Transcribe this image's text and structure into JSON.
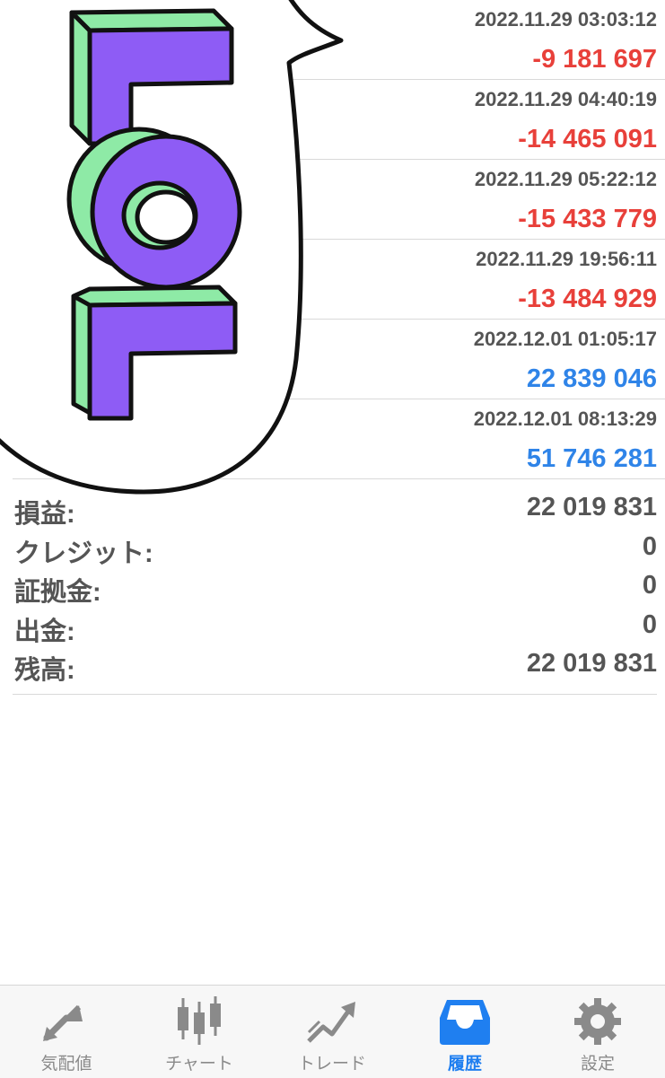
{
  "deals": [
    {
      "time": "2022.11.29 03:03:12",
      "profit": "-9 181 697",
      "sign": "neg"
    },
    {
      "time": "2022.11.29 04:40:19",
      "profit": "-14 465 091",
      "sign": "neg"
    },
    {
      "time": "2022.11.29 05:22:12",
      "profit": "-15 433 779",
      "sign": "neg"
    },
    {
      "time": "2022.11.29 19:56:11",
      "profit": "-13 484 929",
      "sign": "neg"
    },
    {
      "time": "2022.12.01 01:05:17",
      "profit": "22 839 046",
      "sign": "pos"
    },
    {
      "time": "2022.12.01 08:13:29",
      "profit": "51 746 281",
      "sign": "pos"
    }
  ],
  "summary": {
    "profit_label": "損益:",
    "profit_value": "22 019 831",
    "credit_label": "クレジット:",
    "credit_value": "0",
    "deposit_label": "証拠金:",
    "deposit_value": "0",
    "withdrawal_label": "出金:",
    "withdrawal_value": "0",
    "balance_label": "残高:",
    "balance_value": "22 019 831"
  },
  "sticker": {
    "text": "LOL"
  },
  "tabs": [
    {
      "label": "気配値",
      "icon": "quotes-arrows-icon"
    },
    {
      "label": "チャート",
      "icon": "candlestick-chart-icon"
    },
    {
      "label": "トレード",
      "icon": "trade-trend-icon"
    },
    {
      "label": "履歴",
      "icon": "history-tray-icon"
    },
    {
      "label": "設定",
      "icon": "settings-gear-icon"
    }
  ],
  "active_tab": "履歴",
  "colors": {
    "negative": "#e8403a",
    "positive": "#2f84e8",
    "active_tab": "#1f7ff0",
    "inactive_tab": "#8a8a8a"
  }
}
